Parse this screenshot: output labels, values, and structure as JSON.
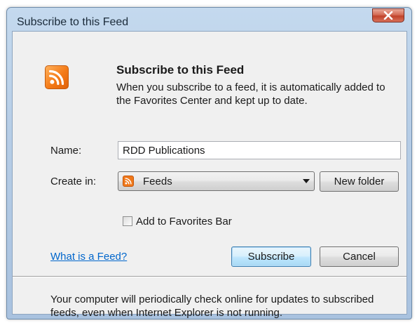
{
  "window": {
    "title": "Subscribe to this Feed",
    "close_icon": "close-x-icon"
  },
  "header": {
    "icon": "rss-feed-icon",
    "heading": "Subscribe to this Feed",
    "description": "When you subscribe to a feed, it is automatically added to the Favorites Center and kept up to date."
  },
  "form": {
    "name_label": "Name:",
    "name_value": "RDD Publications",
    "create_in_label": "Create in:",
    "create_in_selected": "Feeds",
    "create_in_icon": "feed-folder-icon",
    "new_folder_label": "New folder",
    "favorites_bar_label": "Add to Favorites Bar",
    "favorites_bar_checked": false
  },
  "actions": {
    "help_link": "What is a Feed?",
    "subscribe_label": "Subscribe",
    "cancel_label": "Cancel"
  },
  "footer": {
    "note": "Your computer will periodically check online for updates to subscribed feeds, even when Internet Explorer is not running."
  },
  "colors": {
    "accent_orange": "#f47a17",
    "link_blue": "#0066cc",
    "close_red": "#c0432b"
  }
}
